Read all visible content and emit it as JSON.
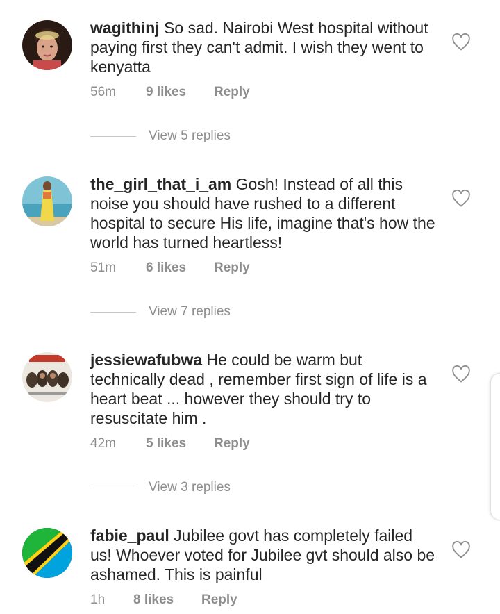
{
  "comments": [
    {
      "username": "wagithinj",
      "text": " So sad. Nairobi West hospital without paying first they can't admit. I wish they went to kenyatta",
      "time": "56m",
      "likes": "9 likes",
      "reply": "Reply",
      "view_replies": "View 5 replies",
      "avatar_icon": "profile-photo-woman"
    },
    {
      "username": "the_girl_that_i_am",
      "text": " Gosh! Instead of all this noise you should have rushed to a different hospital to secure His life, imagine that's how the world has turned heartless!",
      "time": "51m",
      "likes": "6 likes",
      "reply": "Reply",
      "view_replies": "View 7 replies",
      "avatar_icon": "profile-photo-beach"
    },
    {
      "username": "jessiewafubwa",
      "text": " He could be warm but technically dead , remember first sign of life is a heart beat ... however they should try to resuscitate him .",
      "time": "42m",
      "likes": "5 likes",
      "reply": "Reply",
      "view_replies": "View 3 replies",
      "avatar_icon": "profile-photo-monkeys"
    },
    {
      "username": "fabie_paul",
      "text": " Jubilee govt has completely failed us! Whoever voted for Jubilee gvt should also be ashamed. This is painful",
      "time": "1h",
      "likes": "8 likes",
      "reply": "Reply",
      "avatar_icon": "tanzania-flag"
    }
  ],
  "colors": {
    "text": "#262626",
    "secondary": "#8e8e8e",
    "divider": "#c7c7c7"
  },
  "icons": {
    "like": "heart-outline-icon"
  }
}
